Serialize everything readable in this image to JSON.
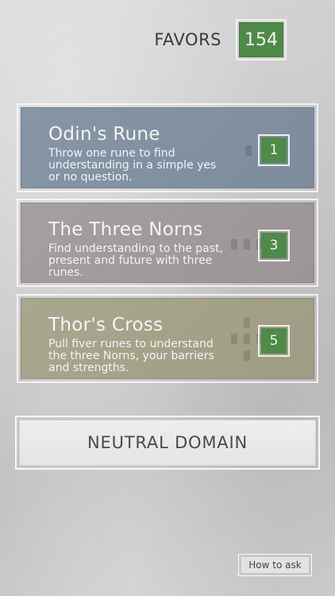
{
  "favors": {
    "label": "FAVORS",
    "value": "154",
    "badge_color": "#4e8a48"
  },
  "spreads": [
    {
      "title": "Odin's Rune",
      "description": "Throw one rune to find understanding in a simple yes or no question.",
      "rune_count": "1",
      "color": "#8796a7"
    },
    {
      "title": "The Three Norns",
      "description": "Find understanding to the past, present and future with three runes.",
      "rune_count": "3",
      "color": "#a59fa2"
    },
    {
      "title": "Thor's Cross",
      "description": "Pull fiver runes to understand the three Norns, your barriers and strengths.",
      "rune_count": "5",
      "color": "#a9a88e"
    }
  ],
  "domain_button": {
    "label": "NEUTRAL DOMAIN"
  },
  "help_button": {
    "label": "How to ask"
  }
}
